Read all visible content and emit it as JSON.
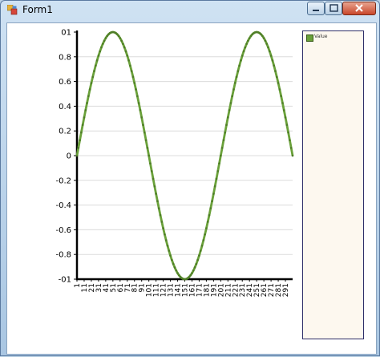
{
  "window": {
    "title": "Form1",
    "icon": "winforms-app-icon",
    "controls": [
      "minimize-icon",
      "maximize-icon",
      "close-icon"
    ]
  },
  "chart_data": {
    "type": "line",
    "title": "",
    "xlabel": "",
    "ylabel": "",
    "series": [
      {
        "name": "Value",
        "color": "#6aa13a",
        "function": "sin",
        "points": 301,
        "step_degrees": 1.8
      }
    ],
    "x": {
      "start": 1,
      "end": 301,
      "step": 1
    },
    "x_tick_labels": [
      "1",
      "11",
      "21",
      "31",
      "41",
      "51",
      "61",
      "71",
      "81",
      "91",
      "101",
      "111",
      "121",
      "131",
      "141",
      "151",
      "161",
      "171",
      "181",
      "191",
      "201",
      "211",
      "221",
      "231",
      "241",
      "251",
      "261",
      "271",
      "281",
      "291"
    ],
    "y_tick_labels": [
      "01",
      "0.8",
      "0.6",
      "0.4",
      "0.2",
      "0",
      "-0.2",
      "-0.4",
      "-0.6",
      "-0.8",
      "-01"
    ],
    "ylim": [
      -1,
      1
    ],
    "grid": true,
    "legend": "right"
  },
  "legend": {
    "items": [
      {
        "label": "Value",
        "color": "#6aa13a"
      }
    ]
  }
}
